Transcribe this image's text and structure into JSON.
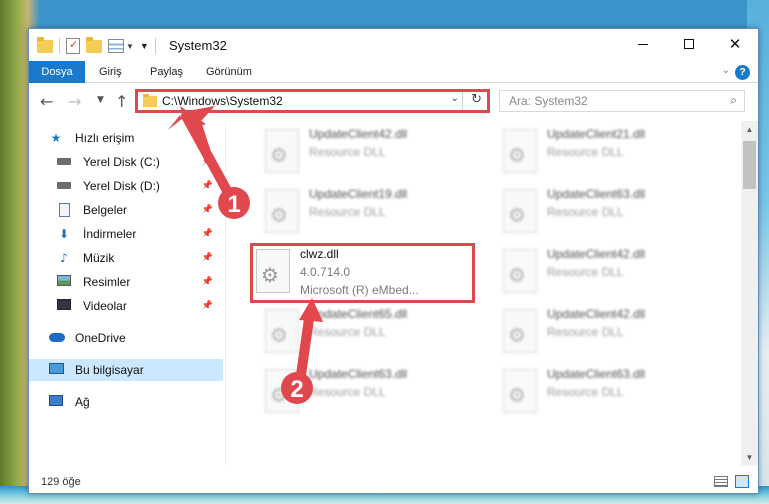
{
  "window": {
    "title": "System32"
  },
  "ribbon": {
    "tabs": [
      "Dosya",
      "Giriş",
      "Paylaş",
      "Görünüm"
    ]
  },
  "nav": {
    "address": "C:\\Windows\\System32",
    "search_placeholder": "Ara: System32"
  },
  "sidebar": {
    "items": [
      {
        "label": "Hızlı erişim",
        "icon": "star-icon"
      },
      {
        "label": "Yerel Disk (C:)",
        "icon": "drive-icon",
        "pinned": true
      },
      {
        "label": "Yerel Disk (D:)",
        "icon": "drive-icon",
        "pinned": true
      },
      {
        "label": "Belgeler",
        "icon": "documents-icon",
        "pinned": true
      },
      {
        "label": "İndirmeler",
        "icon": "downloads-icon",
        "pinned": true
      },
      {
        "label": "Müzik",
        "icon": "music-icon",
        "pinned": true
      },
      {
        "label": "Resimler",
        "icon": "pictures-icon",
        "pinned": true
      },
      {
        "label": "Videolar",
        "icon": "videos-icon",
        "pinned": true
      },
      {
        "label": "OneDrive",
        "icon": "onedrive-icon"
      },
      {
        "label": "Bu bilgisayar",
        "icon": "this-pc-icon",
        "selected": true
      },
      {
        "label": "Ağ",
        "icon": "network-icon"
      }
    ]
  },
  "files": [
    {
      "name": "UpdateClient42.dll",
      "desc": "Resource DLL"
    },
    {
      "name": "UpdateClient21.dll",
      "desc": "Resource DLL"
    },
    {
      "name": "UpdateClient19.dll",
      "desc": "Resource DLL"
    },
    {
      "name": "UpdateClient63.dll",
      "desc": "Resource DLL"
    },
    {
      "name": "clwz.dll",
      "version": "4.0.714.0",
      "desc": "Microsoft (R) eMbed..."
    },
    {
      "name": "UpdateClient42.dll",
      "desc": "Resource DLL"
    },
    {
      "name": "UpdateClient65.dll",
      "desc": "Resource DLL"
    },
    {
      "name": "UpdateClient42.dll",
      "desc": "Resource DLL"
    },
    {
      "name": "UpdateClient63.dll",
      "desc": "Resource DLL"
    },
    {
      "name": "UpdateClient63.dll",
      "desc": "Resource DLL"
    }
  ],
  "status": {
    "item_count": "129 öğe"
  },
  "annotations": {
    "step1": "1",
    "step2": "2",
    "color": "#e0484d"
  }
}
